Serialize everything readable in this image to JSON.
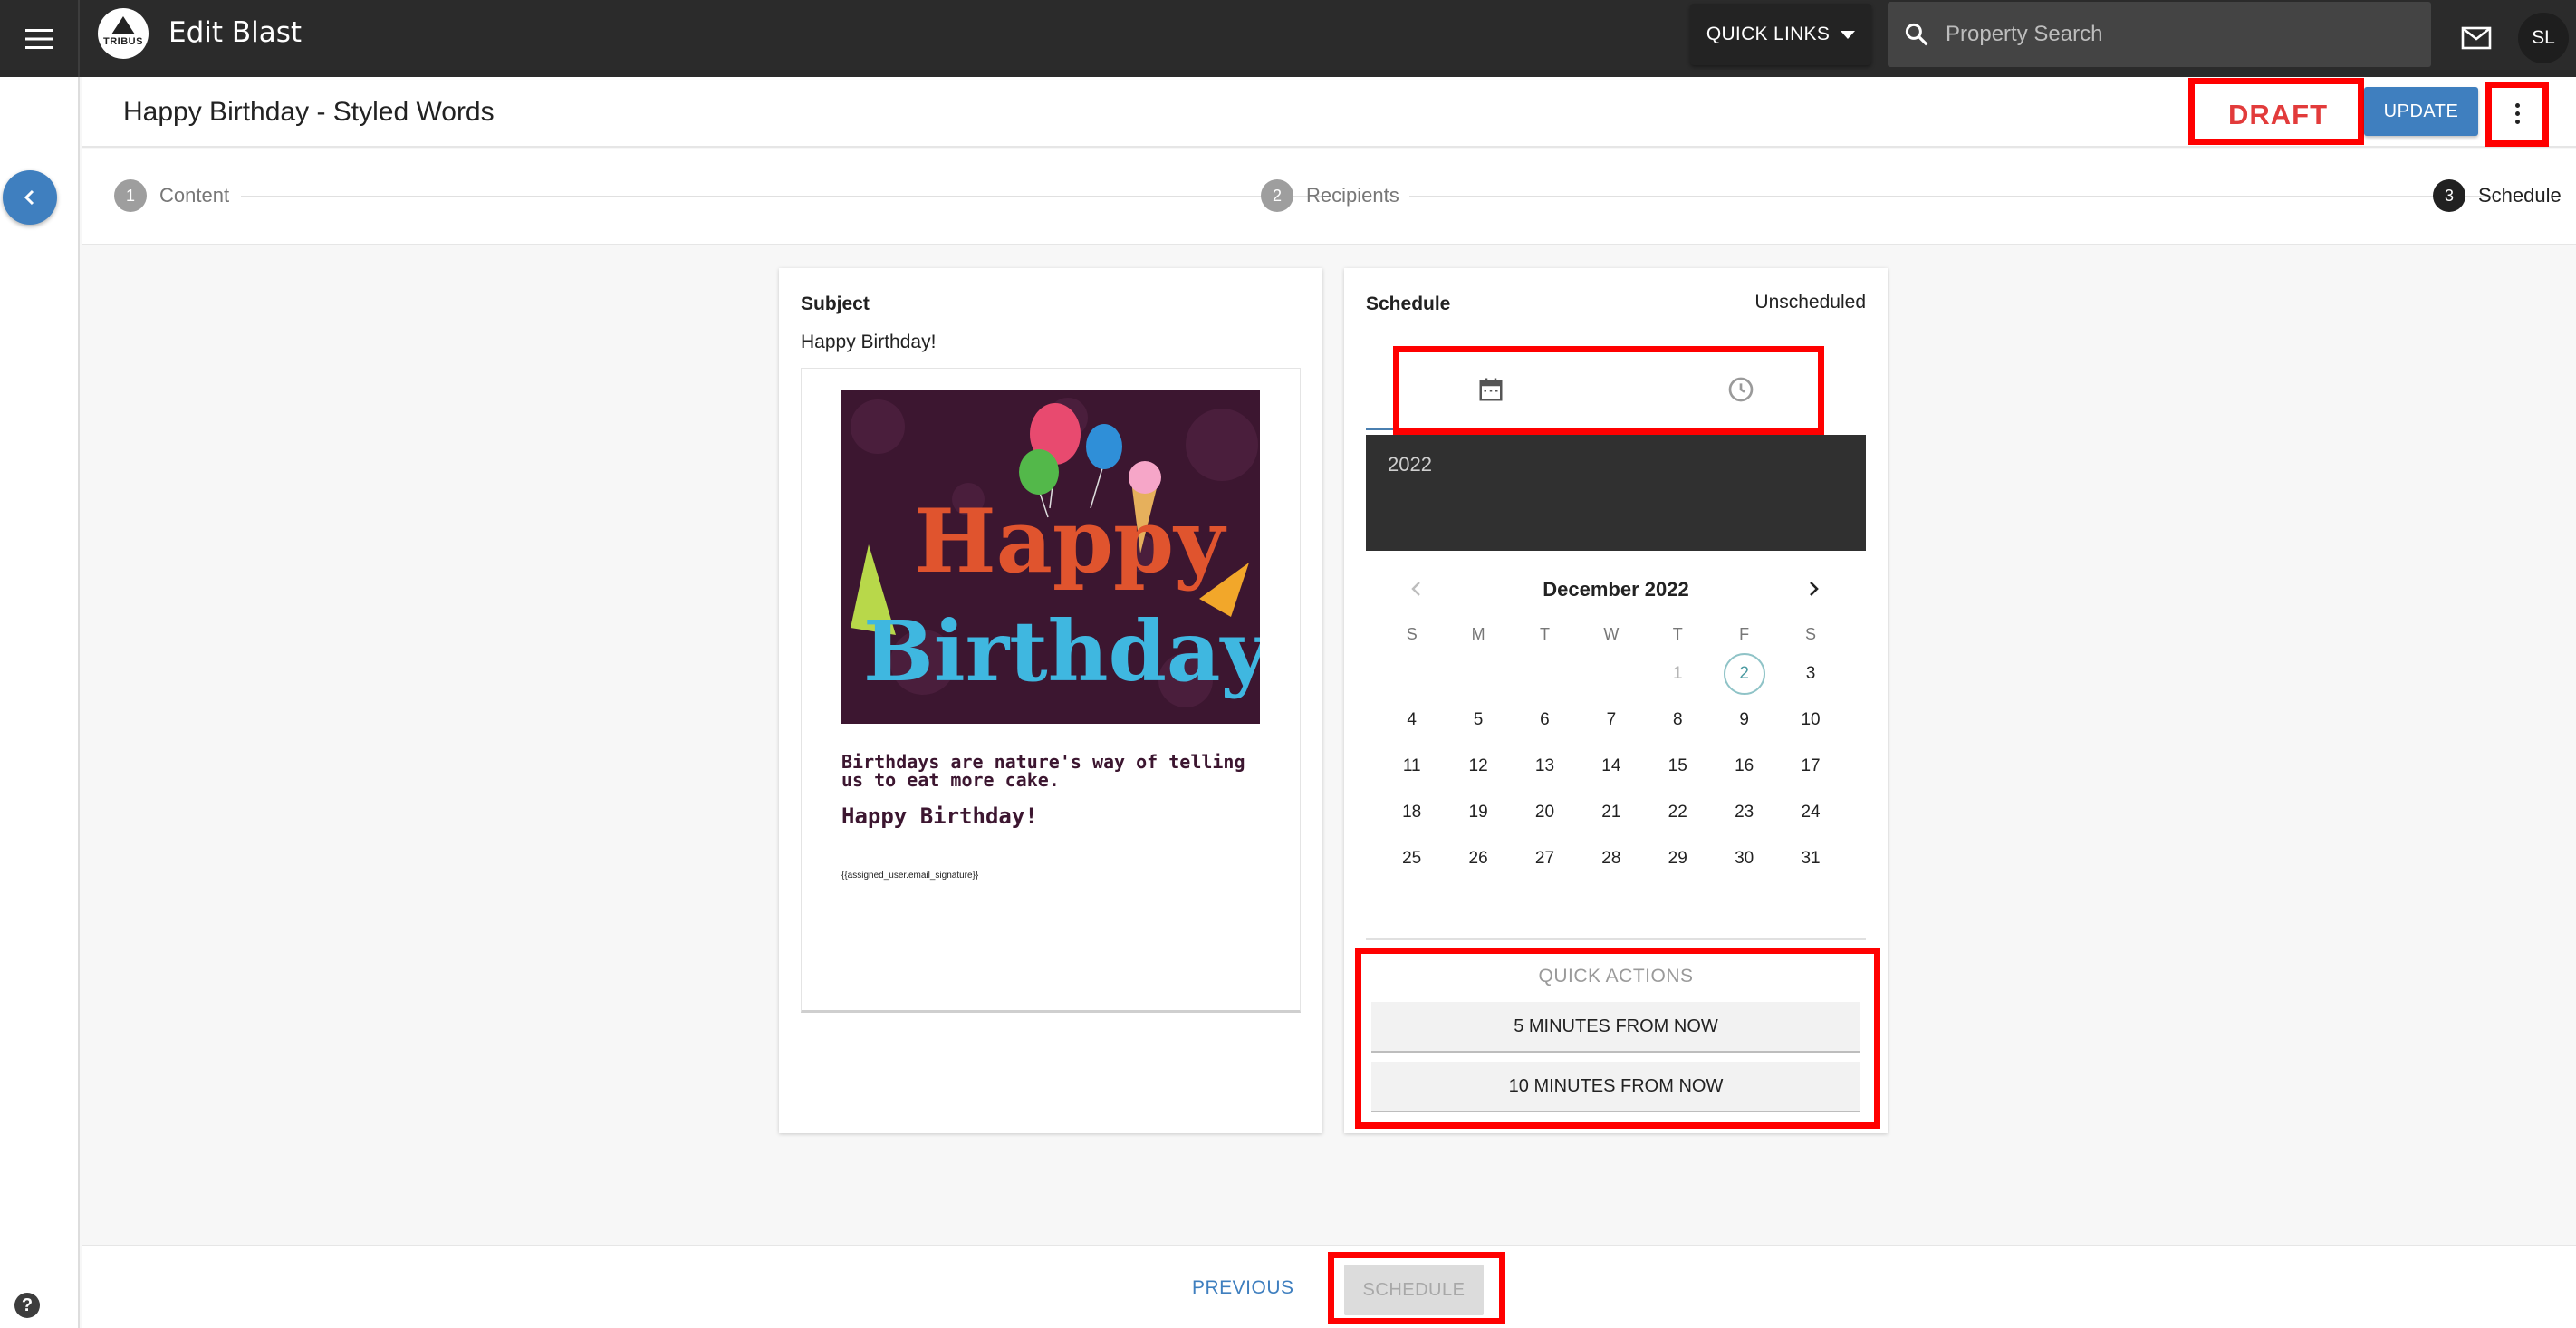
{
  "app": {
    "title": "Edit Blast",
    "logo_text": "TRIBUS"
  },
  "topbar": {
    "quick_links_label": "QUICK LINKS",
    "search_placeholder": "Property Search",
    "avatar_initials": "SL",
    "icons": [
      "hamburger-menu-icon",
      "search-icon",
      "mail-icon",
      "chevron-down-icon"
    ]
  },
  "header": {
    "page_title": "Happy Birthday - Styled Words",
    "status_badge": "DRAFT",
    "update_label": "UPDATE"
  },
  "stepper": {
    "steps": [
      {
        "number": "1",
        "label": "Content",
        "active": false
      },
      {
        "number": "2",
        "label": "Recipients",
        "active": false
      },
      {
        "number": "3",
        "label": "Schedule",
        "active": true
      }
    ]
  },
  "preview": {
    "subject_label": "Subject",
    "subject_value": "Happy Birthday!",
    "image_text_1": "Happy",
    "image_text_2": "Birthday",
    "quote": "Birthdays are nature's way of telling us to eat more cake.",
    "greeting": "Happy Birthday!",
    "signature": "{{assigned_user.email_signature}}"
  },
  "schedule": {
    "label": "Schedule",
    "status": "Unscheduled",
    "tabs": [
      "calendar-icon",
      "clock-icon"
    ],
    "year": "2022",
    "month": "December 2022",
    "weekdays": [
      "S",
      "M",
      "T",
      "W",
      "T",
      "F",
      "S"
    ],
    "weeks": [
      [
        "",
        "",
        "",
        "",
        "1",
        "2",
        "3"
      ],
      [
        "4",
        "5",
        "6",
        "7",
        "8",
        "9",
        "10"
      ],
      [
        "11",
        "12",
        "13",
        "14",
        "15",
        "16",
        "17"
      ],
      [
        "18",
        "19",
        "20",
        "21",
        "22",
        "23",
        "24"
      ],
      [
        "25",
        "26",
        "27",
        "28",
        "29",
        "30",
        "31"
      ]
    ],
    "disabled_day": "1",
    "today": "2",
    "quick_actions_title": "QUICK ACTIONS",
    "quick_actions": [
      "5 MINUTES FROM NOW",
      "10 MINUTES FROM NOW"
    ]
  },
  "footer": {
    "previous_label": "PREVIOUS",
    "schedule_label": "SCHEDULE"
  },
  "colors": {
    "accent": "#3f7fbf",
    "topbar": "#2b2b2b",
    "draft": "#e23b3b",
    "highlight": "#ff0000",
    "calendar_header": "#303030"
  }
}
